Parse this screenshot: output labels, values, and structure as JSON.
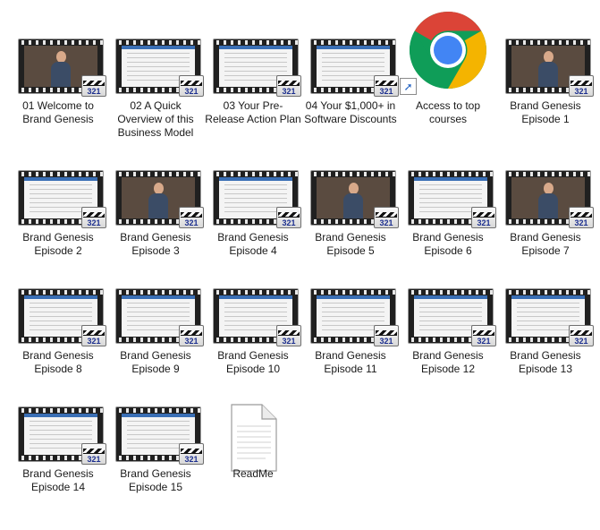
{
  "colors": {
    "chrome_red": "#db4437",
    "chrome_green": "#0f9d58",
    "chrome_yellow": "#f4b400",
    "chrome_blue": "#4285f4",
    "badge_text": "#1c2f8f"
  },
  "files": [
    {
      "id": "f01",
      "label": "01  Welcome to Brand Genesis",
      "icon": "video-file-icon",
      "thumb": "person"
    },
    {
      "id": "f02",
      "label": "02  A Quick Overview of this Business Model",
      "icon": "video-file-icon",
      "thumb": "screen"
    },
    {
      "id": "f03",
      "label": "03  Your Pre-Release Action Plan",
      "icon": "video-file-icon",
      "thumb": "screen"
    },
    {
      "id": "f04",
      "label": "04  Your $1,000+ in Software Discounts",
      "icon": "video-file-icon",
      "thumb": "screen"
    },
    {
      "id": "f05",
      "label": "Access to top courses",
      "icon": "chrome-shortcut-icon",
      "thumb": "chrome"
    },
    {
      "id": "f06",
      "label": "Brand Genesis Episode 1",
      "icon": "video-file-icon",
      "thumb": "person"
    },
    {
      "id": "f07",
      "label": "Brand Genesis Episode 2",
      "icon": "video-file-icon",
      "thumb": "screen"
    },
    {
      "id": "f08",
      "label": "Brand Genesis Episode 3",
      "icon": "video-file-icon",
      "thumb": "person"
    },
    {
      "id": "f09",
      "label": "Brand Genesis Episode 4",
      "icon": "video-file-icon",
      "thumb": "screen"
    },
    {
      "id": "f10",
      "label": "Brand Genesis Episode 5",
      "icon": "video-file-icon",
      "thumb": "person"
    },
    {
      "id": "f11",
      "label": "Brand Genesis Episode 6",
      "icon": "video-file-icon",
      "thumb": "screen"
    },
    {
      "id": "f12",
      "label": "Brand Genesis Episode 7",
      "icon": "video-file-icon",
      "thumb": "person"
    },
    {
      "id": "f13",
      "label": "Brand Genesis Episode 8",
      "icon": "video-file-icon",
      "thumb": "screen"
    },
    {
      "id": "f14",
      "label": "Brand Genesis Episode 9",
      "icon": "video-file-icon",
      "thumb": "screen"
    },
    {
      "id": "f15",
      "label": "Brand Genesis Episode 10",
      "icon": "video-file-icon",
      "thumb": "screen"
    },
    {
      "id": "f16",
      "label": "Brand Genesis Episode 11",
      "icon": "video-file-icon",
      "thumb": "screen"
    },
    {
      "id": "f17",
      "label": "Brand Genesis Episode 12",
      "icon": "video-file-icon",
      "thumb": "screen"
    },
    {
      "id": "f18",
      "label": "Brand Genesis Episode 13",
      "icon": "video-file-icon",
      "thumb": "screen"
    },
    {
      "id": "f19",
      "label": "Brand Genesis Episode 14",
      "icon": "video-file-icon",
      "thumb": "screen"
    },
    {
      "id": "f20",
      "label": "Brand Genesis Episode 15",
      "icon": "video-file-icon",
      "thumb": "screen"
    },
    {
      "id": "f21",
      "label": "ReadMe",
      "icon": "text-document-icon",
      "thumb": "doc"
    }
  ],
  "badge_text": "321"
}
